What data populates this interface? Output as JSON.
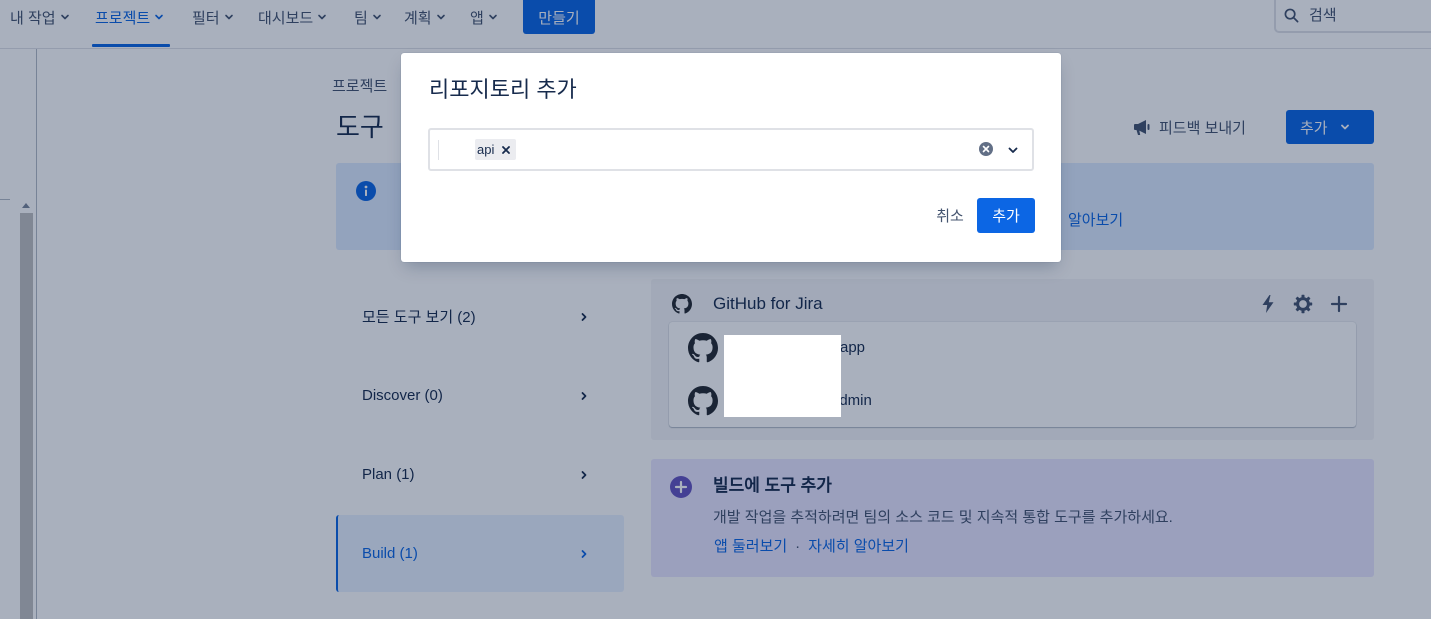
{
  "nav": {
    "items": [
      {
        "label": "내 작업",
        "selected": false
      },
      {
        "label": "프로젝트",
        "selected": true
      },
      {
        "label": "필터",
        "selected": false
      },
      {
        "label": "대시보드",
        "selected": false
      },
      {
        "label": "팀",
        "selected": false
      },
      {
        "label": "계획",
        "selected": false
      },
      {
        "label": "앱",
        "selected": false
      }
    ],
    "create_label": "만들기",
    "search_placeholder": "검색"
  },
  "page": {
    "breadcrumb": "프로젝트",
    "title": "도구",
    "feedback_label": "피드백 보내기",
    "add_button_label": "추가",
    "info_banner": {
      "learn_more_link": "알아보기"
    },
    "categories": [
      {
        "label": "모든 도구 보기 (2)",
        "selected": false
      },
      {
        "label": "Discover (0)",
        "selected": false
      },
      {
        "label": "Plan (1)",
        "selected": false
      },
      {
        "label": "Build (1)",
        "selected": true
      }
    ],
    "github_card": {
      "title": "GitHub for Jira",
      "action_icons": [
        "lightning-icon",
        "gear-icon",
        "plus-icon"
      ],
      "repositories": [
        {
          "name": "app"
        },
        {
          "name": "admin"
        }
      ]
    },
    "add_tools_card": {
      "title": "빌드에 도구 추가",
      "description": "개발 작업을 추적하려면 팀의 소스 코드 및 지속적 통합 도구를 추가하세요.",
      "browse_apps_link": "앱 둘러보기",
      "separator": "·",
      "learn_more_link": "자세히 알아보기"
    }
  },
  "modal": {
    "title": "리포지토리 추가",
    "selected_repositories": [
      {
        "label": "api"
      }
    ],
    "cancel_label": "취소",
    "confirm_label": "추가"
  },
  "colors": {
    "brand_blue": "#0C66E4",
    "text": "#172B4D",
    "subtle_text": "#44546F",
    "selected_bg": "#E9F2FF",
    "info_bg": "#DEEBFF",
    "card_bg": "#F4F5F7",
    "add_tools_bg": "#EAE6FF",
    "add_tools_icon": "#6554C0",
    "blanket": "rgba(9, 30, 66, 0.35)"
  }
}
